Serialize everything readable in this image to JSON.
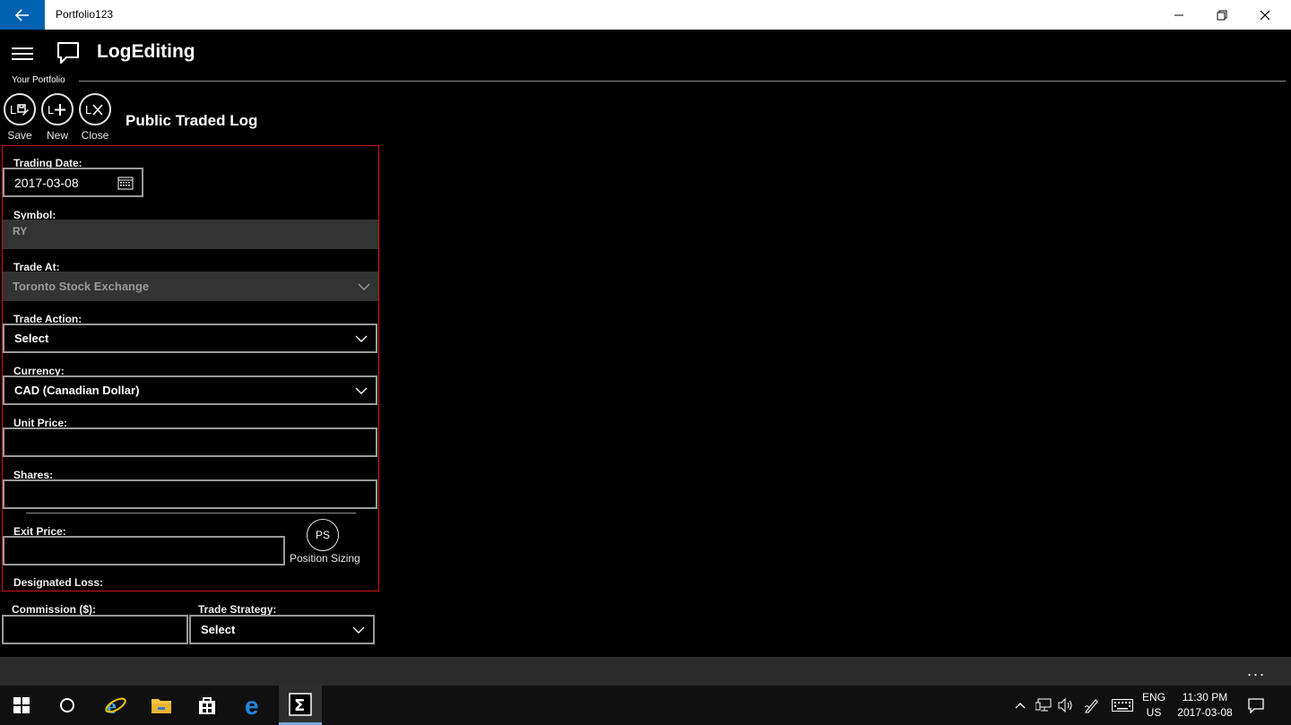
{
  "window": {
    "title": "Portfolio123"
  },
  "header": {
    "title": "LogEditing",
    "breadcrumb": "Your Portfolio"
  },
  "commands": [
    {
      "glyph": "L🖊",
      "label": "Save"
    },
    {
      "glyph": "L+",
      "label": "New"
    },
    {
      "glyph": "LX",
      "label": "Close"
    }
  ],
  "section_title": "Public Traded Log",
  "form": {
    "trading_date": {
      "label": "Trading Date:",
      "value": "2017-03-08"
    },
    "symbol": {
      "label": "Symbol:",
      "value": "RY"
    },
    "trade_at": {
      "label": "Trade At:",
      "value": "Toronto Stock Exchange"
    },
    "trade_action": {
      "label": "Trade Action:",
      "value": "Select"
    },
    "currency": {
      "label": "Currency:",
      "value": "CAD (Canadian Dollar)"
    },
    "unit_price": {
      "label": "Unit Price:",
      "value": ""
    },
    "shares": {
      "label": "Shares:",
      "value": ""
    },
    "exit_price": {
      "label": "Exit Price:",
      "value": ""
    },
    "position_sizing": {
      "glyph": "PS",
      "label": "Position Sizing"
    },
    "designated_loss": {
      "label": "Designated Loss:"
    },
    "commission": {
      "label": "Commission ($):",
      "value": ""
    },
    "trade_strategy": {
      "label": "Trade Strategy:",
      "value": "Select"
    }
  },
  "appbar": {
    "more": "..."
  },
  "taskbar": {
    "lang_top": "ENG",
    "lang_bottom": "US",
    "time": "11:30 PM",
    "date": "2017-03-08"
  },
  "colors": {
    "accent": "#0063b1",
    "panel_border": "#d0101b",
    "disabled_bg": "#333333"
  }
}
